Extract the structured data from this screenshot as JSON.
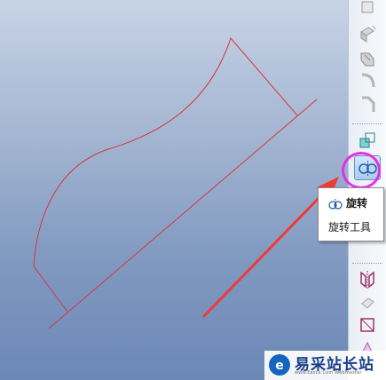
{
  "tooltip": {
    "title": "旋转",
    "description": "旋转工具"
  },
  "toolbar": {
    "buttons": [
      {
        "name": "datum-plane-icon"
      },
      {
        "name": "extrude-icon"
      },
      {
        "name": "sweep-icon"
      },
      {
        "name": "round-icon"
      },
      {
        "name": "chamfer-icon"
      },
      {
        "name": "pattern-icon"
      },
      {
        "name": "revolve-icon"
      },
      {
        "name": "mirror-icon"
      },
      {
        "name": "shell-icon"
      },
      {
        "name": "sketch-icon"
      },
      {
        "name": "draft-icon"
      }
    ]
  },
  "watermark": {
    "text": "易采站长站",
    "subtext": "www.Easck.Com Webmaster"
  },
  "colors": {
    "sketch_line": "#d6363c",
    "arrow": "#f03a36",
    "highlight": "#e033e6"
  }
}
